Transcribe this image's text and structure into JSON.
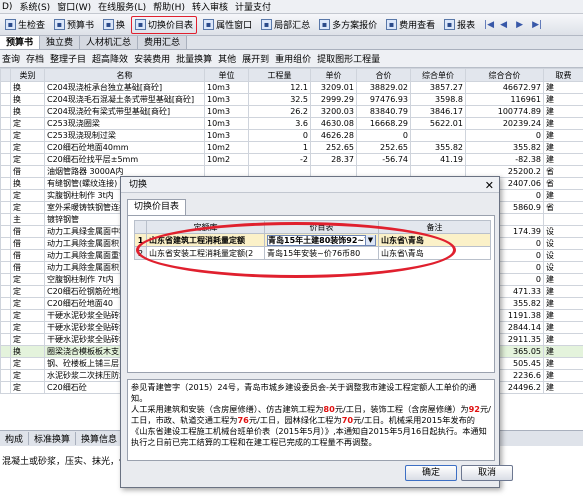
{
  "menubar": {
    "items": [
      "D)",
      "系统(S)",
      "窗口(W)",
      "在线服务(L)",
      "帮助(H)",
      "转入审核",
      "计量支付"
    ]
  },
  "toolbar": {
    "items": [
      "生检查",
      "预算书",
      "换",
      "切换价目表",
      "属性窗口",
      "局部汇总",
      "多方案报价",
      "费用查看",
      "报表"
    ]
  },
  "tabs": [
    "预算书",
    "独立费",
    "人材机汇总",
    "费用汇总"
  ],
  "subtoolbar": {
    "items": [
      "查询",
      "存档",
      "整理子目",
      "超高降效",
      "安装费用",
      "批量换算",
      "其他",
      "展开到",
      "重用组价",
      "提取图形工程量"
    ]
  },
  "grid": {
    "columns": [
      "",
      "类别",
      "名称",
      "单位",
      "工程量",
      "单价",
      "合价",
      "综合单价",
      "综合合价",
      "取费"
    ],
    "rows": [
      [
        "",
        "换",
        "C204现浇桩承台独立基础[商砼]",
        "10m3",
        "12.1",
        "3209.01",
        "38829.02",
        "3857.27",
        "46672.97",
        "建"
      ],
      [
        "",
        "换",
        "C204现浇毛石混凝土条式带型基础[商砼]",
        "10m3",
        "32.5",
        "2999.29",
        "97476.93",
        "3598.8",
        "116961",
        "建"
      ],
      [
        "",
        "换",
        "C204现浇砼有梁式带型基础[商砼]",
        "10m3",
        "26.2",
        "3200.03",
        "83840.79",
        "3846.17",
        "100774.89",
        "建"
      ],
      [
        "",
        "定",
        "C253现浇圈梁",
        "10m3",
        "3.6",
        "4630.08",
        "16668.29",
        "5622.01",
        "20239.24",
        "建"
      ],
      [
        "",
        "定",
        "C253现浇现制过梁",
        "10m3",
        "0",
        "4626.28",
        "0",
        "",
        "0",
        "建"
      ],
      [
        "",
        "定",
        "C20细石砼地面40mm",
        "10m2",
        "1",
        "252.65",
        "252.65",
        "355.82",
        "355.82",
        "建"
      ],
      [
        "",
        "定",
        "C20细石砼找平层±5mm",
        "10m2",
        "-2",
        "28.37",
        "-56.74",
        "41.19",
        "-82.38",
        "建"
      ],
      [
        "",
        "借",
        "油烟管路器 3000A内",
        "",
        "",
        "",
        "",
        "",
        "25200.2",
        "省"
      ],
      [
        "",
        "换",
        "有缝钢管(螺纹连接)",
        "",
        "",
        "",
        "",
        "",
        "2407.06",
        "省"
      ],
      [
        "",
        "定",
        "实腹钢柱制作 3t内",
        "",
        "",
        "",
        "",
        "",
        "0",
        "建"
      ],
      [
        "",
        "定",
        "室外采暖铸铁钢管连接",
        "",
        "",
        "",
        "",
        "",
        "5860.9",
        "省"
      ],
      [
        "",
        "主",
        "镀锌钢管",
        "",
        "",
        "",
        "",
        "",
        "",
        ""
      ],
      [
        "",
        "借",
        "动力工具绿金属面中积",
        "",
        "",
        "",
        "",
        "",
        "174.39",
        "设"
      ],
      [
        "",
        "借",
        "动力工具除金属面积",
        "",
        "",
        "",
        "",
        "",
        "0",
        "设"
      ],
      [
        "",
        "借",
        "动力工具除金属面重锈",
        "",
        "",
        "",
        "",
        "",
        "0",
        "设"
      ],
      [
        "",
        "借",
        "动力工具除金属面积",
        "",
        "",
        "",
        "",
        "",
        "0",
        "设"
      ],
      [
        "",
        "定",
        "空腹钢柱制作 7t内",
        "",
        "",
        "",
        "",
        "",
        "0",
        "建"
      ],
      [
        "",
        "定",
        "C20细石砼钢筋砼地面40",
        "",
        "",
        "",
        "",
        "",
        "471.33",
        "建"
      ],
      [
        "",
        "定",
        "C20细石砼地面40",
        "",
        "",
        "",
        "",
        "",
        "355.82",
        "建"
      ],
      [
        "",
        "定",
        "干硬水泥砂浆全贴砖地面",
        "",
        "",
        "",
        "",
        "",
        "1191.38",
        "建"
      ],
      [
        "",
        "定",
        "干硬水泥砂浆全贴砖地面",
        "",
        "",
        "",
        "",
        "",
        "2844.14",
        "建"
      ],
      [
        "",
        "定",
        "干硬水泥砂浆全贴砖地面",
        "",
        "",
        "",
        "",
        "",
        "2911.35",
        "建"
      ],
      [
        "",
        "换",
        "圈梁浇合模板板木支",
        "",
        "",
        "",
        "",
        "",
        "365.05",
        "建"
      ],
      [
        "",
        "定",
        "钢、砼楼板上铺三层",
        "",
        "",
        "",
        "",
        "",
        "505.45",
        "建"
      ],
      [
        "",
        "定",
        "水泥砂浆二次抹压防水",
        "",
        "",
        "",
        "",
        "",
        "2236.6",
        "建"
      ],
      [
        "",
        "定",
        "C20细石砼",
        "",
        "",
        "",
        "",
        "",
        "24496.2",
        "建"
      ]
    ]
  },
  "bottom_tabs": [
    "构成",
    "标准换算",
    "换算信息"
  ],
  "description_text": "混凝土或砂浆，压实、抹光，做分",
  "dialog": {
    "title": "切换",
    "tab_label": "切换价目表",
    "columns": [
      "",
      "定额库",
      "价目表",
      "备注"
    ],
    "rows": [
      {
        "index": "1",
        "library": "山东省建筑工程消耗量定额",
        "price_table": "青岛15年土建80装饰92~76",
        "remark": "山东省\\青岛"
      },
      {
        "index": "2",
        "library": "山东省安装工程消耗量定额(2",
        "price_table": "青岛15年安装~价76币80",
        "remark": "山东省\\青岛"
      }
    ],
    "notice": {
      "p1": "参见青建管字（2015）24号，青岛市城乡建设委员会-关于调整我市建设工程定额人工单价的通知。",
      "p2a": "人工采用建筑和安装（含房屋修缮）、仿古建筑工程为",
      "v1": "80",
      "p2b": "元/工日，装饰工程（含房屋修缮）为",
      "v2": "92",
      "p2c": "元/工日，市政、轨道交通工程为",
      "v3": "76",
      "p2d": "元/工日，园林绿化工程为",
      "v4": "70",
      "p2e": "元/工日。机械采用2015年发布的《山东省建设工程施工机械台班单价表（2015年5月）》,本通知自2015年5月16日起执行。本通知执行之日前已完工结算的工程和在建工程已完成的工程量不再调整。"
    },
    "ok_label": "确定",
    "cancel_label": "取消"
  },
  "colors": {
    "highlight": "#e0202e",
    "selected_row": "#e4f3dc"
  }
}
